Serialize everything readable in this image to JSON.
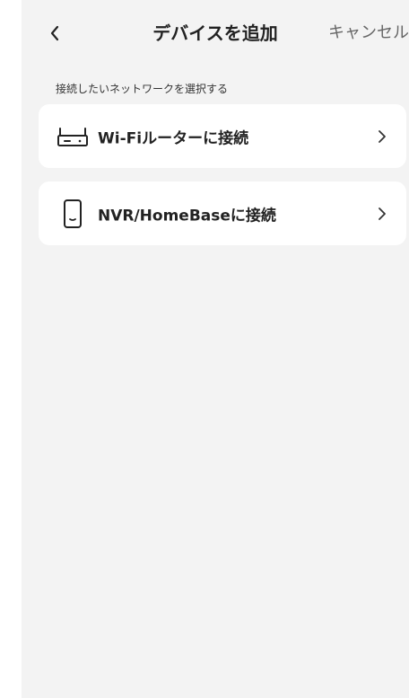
{
  "header": {
    "title": "デバイスを追加",
    "cancel_label": "キャンセル",
    "back_icon": "chevron-left-icon"
  },
  "section": {
    "label": "接続したいネットワークを選択する"
  },
  "options": [
    {
      "label": "Wi-Fiルーターに接続",
      "icon": "router-icon"
    },
    {
      "label": "NVR/HomeBaseに接続",
      "icon": "homebase-icon"
    }
  ],
  "colors": {
    "background": "#f3f3f3",
    "card": "#ffffff",
    "text": "#222222",
    "muted": "#666666"
  }
}
